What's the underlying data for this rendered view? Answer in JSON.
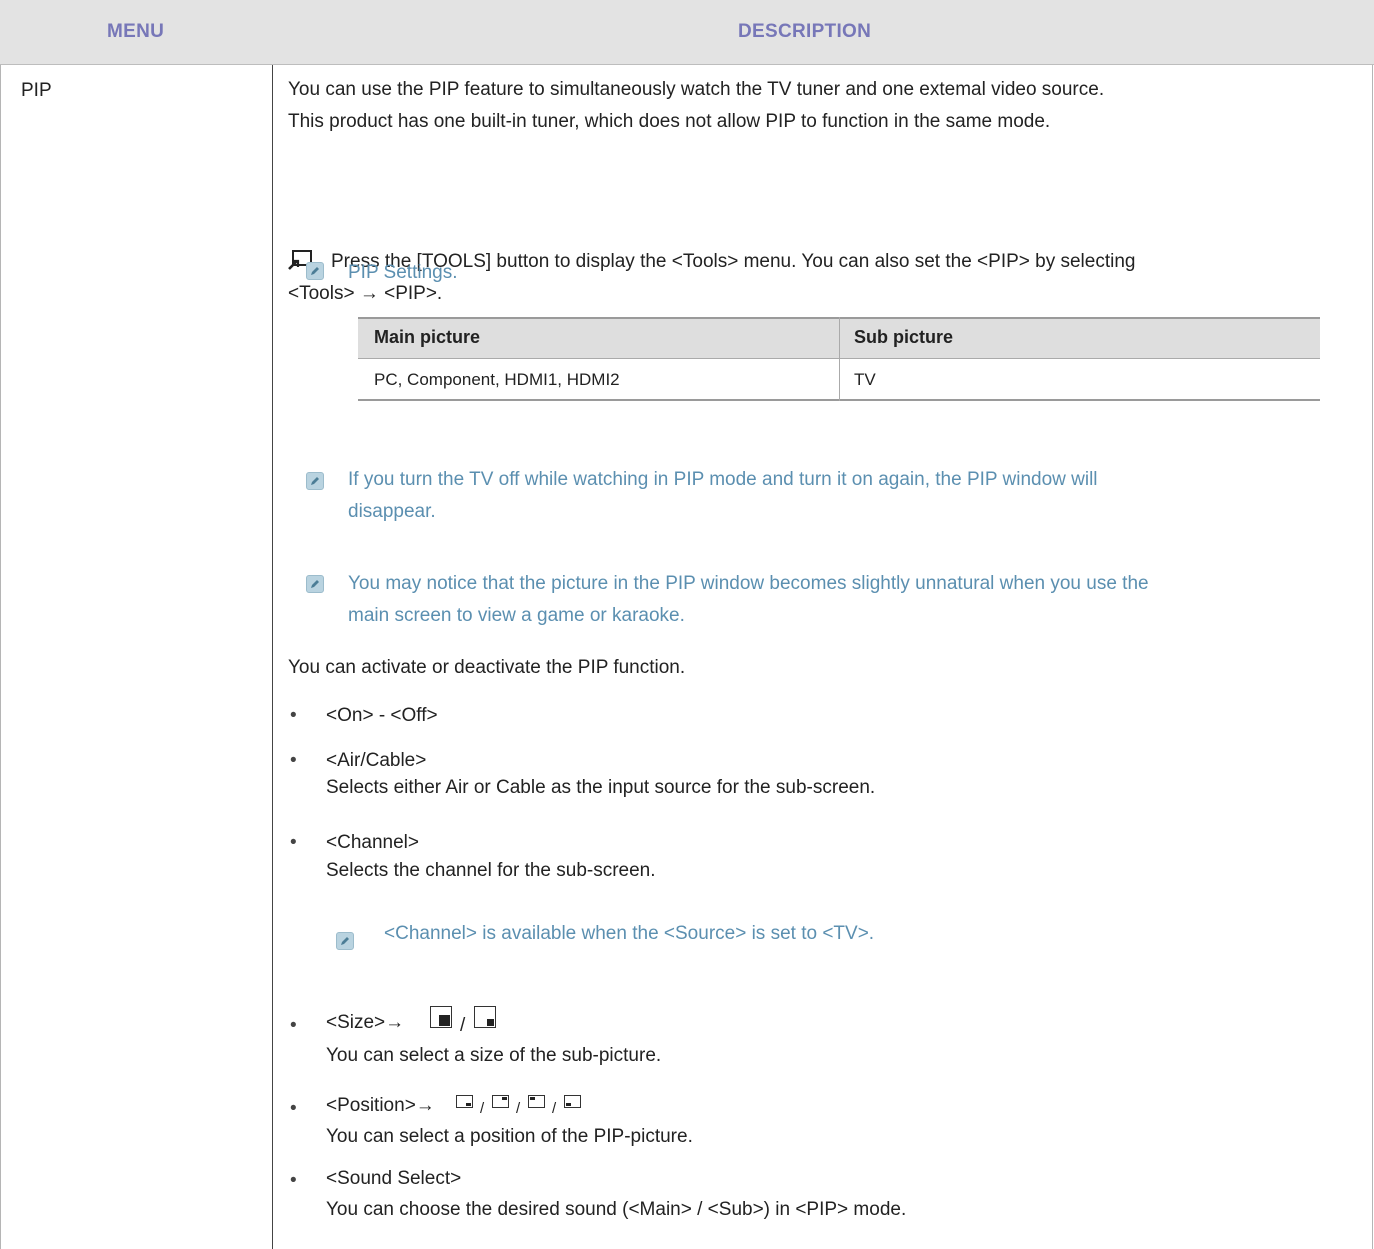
{
  "header": {
    "menu": "MENU",
    "description": "DESCRIPTION"
  },
  "menu_item": "PIP",
  "intro": {
    "line1": "You can use the PIP feature to simultaneously watch the TV tuner and one extemal video source.",
    "line2": "This product has one built-in tuner, which does not allow PIP to function in the same mode."
  },
  "tools": {
    "line1": "Press the [TOOLS] button to display the <Tools> menu. You can also set the <PIP> by selecting",
    "line2": "<Tools> → <PIP>."
  },
  "pip_settings_title": "PIP Settings.",
  "settings_table": {
    "headers": [
      "Main picture",
      "Sub picture"
    ],
    "rows": [
      [
        "PC, Component, HDMI1, HDMI2",
        "TV"
      ]
    ]
  },
  "notes": {
    "tv_off_line1": "If you turn the TV off while watching in PIP mode and turn it on again, the PIP window will",
    "tv_off_line2": "disappear.",
    "unnatural_line1": "You may notice that the picture in the PIP window becomes slightly unnatural when you use the",
    "unnatural_line2": "main screen to view a game or karaoke."
  },
  "activate_text": "You can activate or deactivate the PIP function.",
  "options": {
    "on_off": "<On> - <Off>",
    "air_cable": "<Air/Cable>",
    "air_cable_desc": "Selects either Air or Cable as the input source for the sub-screen.",
    "channel": "<Channel>",
    "channel_desc": "Selects the channel for the sub-screen.",
    "channel_note": "<Channel> is available when the <Source> is set to <TV>.",
    "size": "<Size>→",
    "size_desc": "You can select a size of the sub-picture.",
    "position": "<Position>→",
    "position_desc": "You can select a position of the PIP-picture.",
    "sound": "<Sound Select>",
    "sound_desc": "You can choose the desired sound (<Main> / <Sub>) in <PIP> mode."
  },
  "bullet_char": "•",
  "separator": "/",
  "colors": {
    "header_bg": "#e3e3e3",
    "header_text": "#7777b8",
    "note_text": "#5b8fb0",
    "note_icon": "#b9d3e0"
  }
}
